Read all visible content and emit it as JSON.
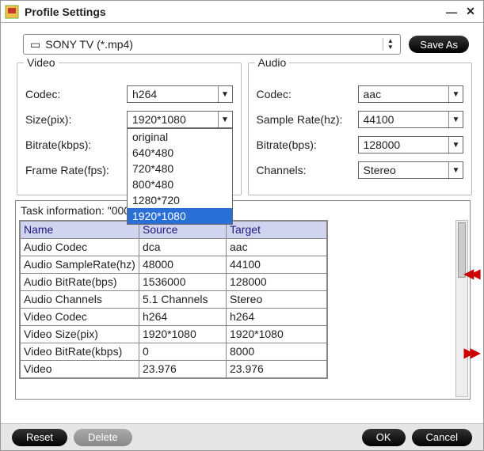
{
  "window": {
    "title": "Profile Settings"
  },
  "top": {
    "profile": "SONY TV (*.mp4)",
    "save_as": "Save As"
  },
  "video": {
    "title": "Video",
    "codec_label": "Codec:",
    "codec_value": "h264",
    "size_label": "Size(pix):",
    "size_value": "1920*1080",
    "size_options": [
      "original",
      "640*480",
      "720*480",
      "800*480",
      "1280*720",
      "1920*1080"
    ],
    "bitrate_label": "Bitrate(kbps):",
    "framerate_label": "Frame Rate(fps):"
  },
  "audio": {
    "title": "Audio",
    "codec_label": "Codec:",
    "codec_value": "aac",
    "samplerate_label": "Sample Rate(hz):",
    "samplerate_value": "44100",
    "bitrate_label": "Bitrate(bps):",
    "bitrate_value": "128000",
    "channels_label": "Channels:",
    "channels_value": "Stereo"
  },
  "task": {
    "label_prefix": "Task information: \"",
    "filename": "00010.m2ts",
    "headers": {
      "name": "Name",
      "source": "Source",
      "target": "Target"
    },
    "rows": [
      {
        "name": "Audio Codec",
        "src": "dca",
        "tgt": "aac"
      },
      {
        "name": "Audio SampleRate(hz)",
        "src": "48000",
        "tgt": "44100"
      },
      {
        "name": "Audio BitRate(bps)",
        "src": "1536000",
        "tgt": "128000"
      },
      {
        "name": "Audio Channels",
        "src": "5.1 Channels",
        "tgt": "Stereo"
      },
      {
        "name": "Video Codec",
        "src": "h264",
        "tgt": "h264"
      },
      {
        "name": "Video Size(pix)",
        "src": "1920*1080",
        "tgt": "1920*1080"
      },
      {
        "name": "Video BitRate(kbps)",
        "src": "0",
        "tgt": "8000"
      },
      {
        "name": "Video",
        "src": "23.976",
        "tgt": "23.976"
      }
    ]
  },
  "bottom": {
    "reset": "Reset",
    "delete": "Delete",
    "ok": "OK",
    "cancel": "Cancel"
  }
}
